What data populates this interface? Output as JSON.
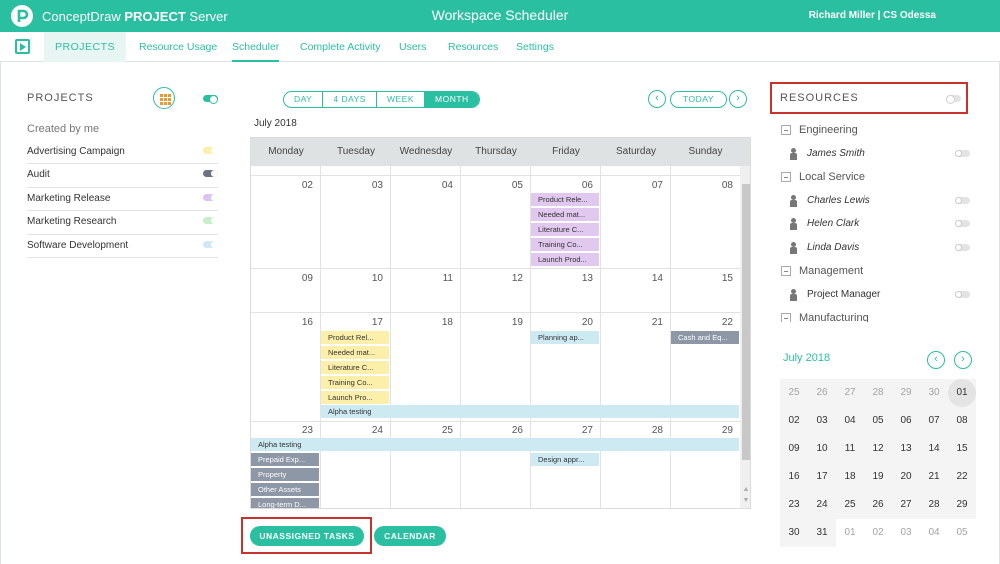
{
  "brand": {
    "name": "ConceptDraw",
    "product": "PROJECT",
    "suffix": "Server"
  },
  "header": {
    "title": "Workspace Scheduler",
    "user": "Richard Miller | CS Odessa"
  },
  "nav": {
    "items": [
      "PROJECTS",
      "Resource Usage",
      "Scheduler",
      "Complete Activity",
      "Users",
      "Resources",
      "Settings"
    ],
    "active": "Scheduler"
  },
  "projects": {
    "title": "PROJECTS",
    "section": "Created by me",
    "items": [
      {
        "name": "Advertising Campaign",
        "color": "#fcefa9"
      },
      {
        "name": "Audit",
        "color": "#6b7483"
      },
      {
        "name": "Marketing Release",
        "color": "#dcc4ee"
      },
      {
        "name": "Marketing Research",
        "color": "#c9efc8"
      },
      {
        "name": "Software Development",
        "color": "#cdeaf2"
      }
    ]
  },
  "calendar": {
    "views": [
      "DAY",
      "4 DAYS",
      "WEEK",
      "MONTH"
    ],
    "active_view": "MONTH",
    "today_label": "TODAY",
    "month_label": "July 2018",
    "weekdays": [
      "Monday",
      "Tuesday",
      "Wednesday",
      "Thursday",
      "Friday",
      "Saturday",
      "Sunday"
    ],
    "weeks": [
      [
        "02",
        "03",
        "04",
        "05",
        "06",
        "07",
        "08"
      ],
      [
        "09",
        "10",
        "11",
        "12",
        "13",
        "14",
        "15"
      ],
      [
        "16",
        "17",
        "18",
        "19",
        "20",
        "21",
        "22"
      ],
      [
        "23",
        "24",
        "25",
        "26",
        "27",
        "28",
        "29"
      ]
    ],
    "events": {
      "fri06": [
        "Product Rele...",
        "Needed mat...",
        "Literature C...",
        "Training Co...",
        "Launch Prod..."
      ],
      "tue17": [
        "Product Rel...",
        "Needed mat...",
        "Literature C...",
        "Training Co...",
        "Launch Pro..."
      ],
      "fri20": "Planning ap...",
      "sun22": "Cash and Eq...",
      "alpha1": "Alpha testing",
      "alpha2": "Alpha testing",
      "mon23": [
        "Prepaid Exp...",
        "Property",
        "Other Assets",
        "Long-term D..."
      ],
      "fri27": "Design appr..."
    }
  },
  "buttons": {
    "unassigned": "UNASSIGNED TASKS",
    "calendar": "CALENDAR"
  },
  "resources": {
    "title": "RESOURCES",
    "groups": [
      {
        "name": "Engineering",
        "members": [
          "James Smith"
        ]
      },
      {
        "name": "Local Service",
        "members": [
          "Charles Lewis",
          "Helen Clark",
          "Linda Davis"
        ]
      },
      {
        "name": "Management",
        "members": [
          "Project Manager"
        ]
      },
      {
        "name": "Manufacturing",
        "members": []
      }
    ]
  },
  "mini_calendar": {
    "title": "July 2018",
    "rows": [
      [
        "25",
        "26",
        "27",
        "28",
        "29",
        "30",
        "01"
      ],
      [
        "02",
        "03",
        "04",
        "05",
        "06",
        "07",
        "08"
      ],
      [
        "09",
        "10",
        "11",
        "12",
        "13",
        "14",
        "15"
      ],
      [
        "16",
        "17",
        "18",
        "19",
        "20",
        "21",
        "22"
      ],
      [
        "23",
        "24",
        "25",
        "26",
        "27",
        "28",
        "29"
      ],
      [
        "30",
        "31",
        "01",
        "02",
        "03",
        "04",
        "05"
      ]
    ],
    "today": "01"
  },
  "colors": {
    "accent": "#2bbfa2",
    "highlight": "#c7322a"
  }
}
